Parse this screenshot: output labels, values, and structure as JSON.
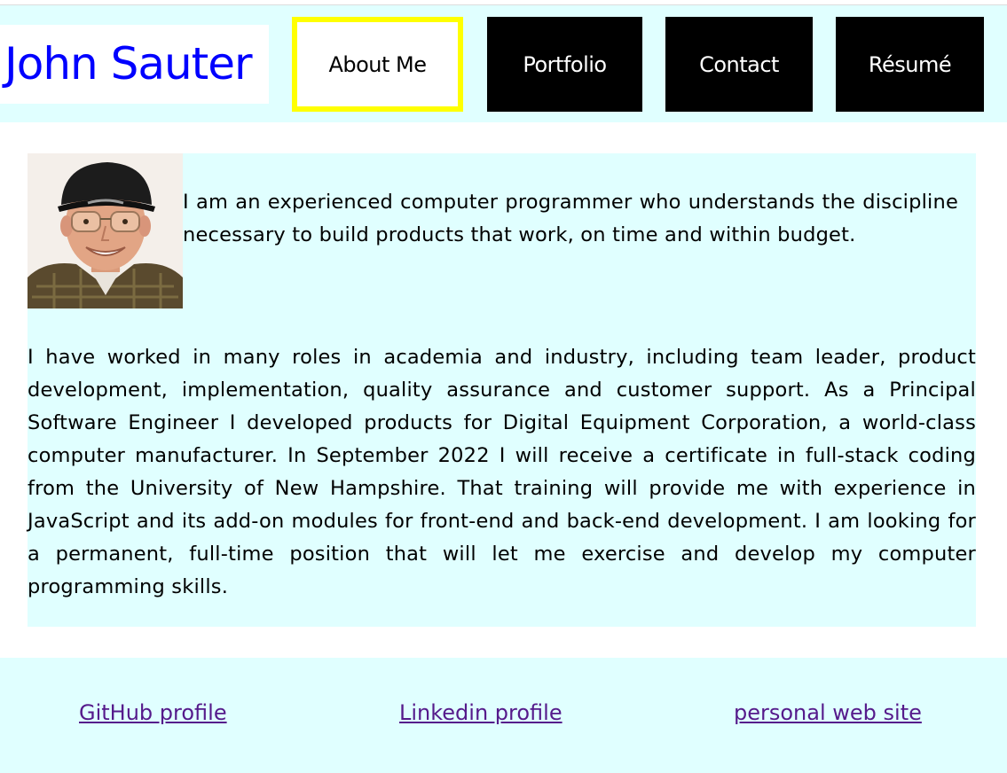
{
  "header": {
    "site_title": "John Sauter",
    "nav": [
      {
        "label": "About Me",
        "active": true
      },
      {
        "label": "Portfolio",
        "active": false
      },
      {
        "label": "Contact",
        "active": false
      },
      {
        "label": "Résumé",
        "active": false
      }
    ]
  },
  "main": {
    "photo_icon": "portrait-photo",
    "intro": "I am an experienced computer programmer who understands the discipline necessary to build products that work, on time and within budget.",
    "bio": "I have worked in many roles in academia and industry, including team leader, product development, implementation, quality assurance and customer support. As a Principal Software Engineer I developed products for Digital Equipment Corporation, a world-class computer manufacturer. In September 2022 I will receive a certificate in full-stack coding from the University of New Hampshire. That training will provide me with experience in JavaScript and its add-on modules for front-end and back-end development. I am looking for a permanent, full-time position that will let me exercise and develop my computer programming skills."
  },
  "footer": {
    "links": [
      {
        "label": "GitHub profile"
      },
      {
        "label": "Linkedin profile"
      },
      {
        "label": "personal web site"
      }
    ]
  },
  "colors": {
    "panel_bg": "#e0ffff",
    "title_color": "#0000ff",
    "active_border": "#ffff00",
    "nav_bg": "#000000",
    "visited_link": "#551a8b"
  }
}
